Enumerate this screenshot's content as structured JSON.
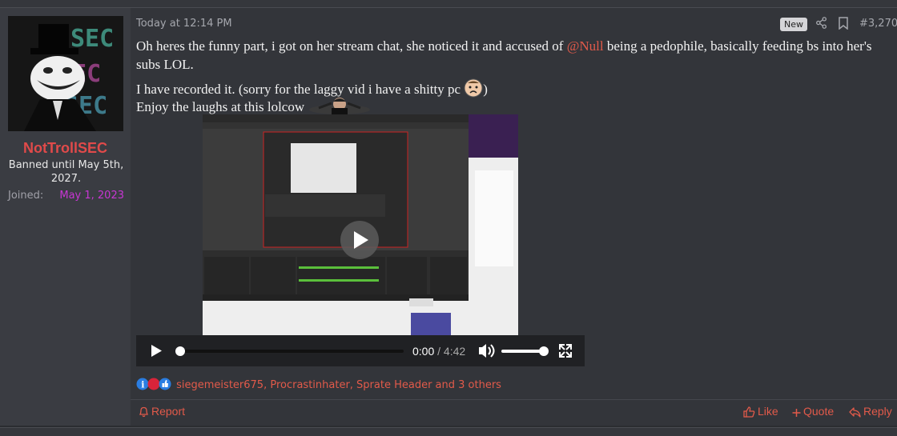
{
  "user": {
    "name": "NotTrollSEC",
    "banned": "Banned until May 5th, 2027.",
    "joined_label": "Joined:",
    "joined_value": "May 1, 2023",
    "avatar_text": "SEC"
  },
  "post": {
    "time": "Today at 12:14 PM",
    "new_badge": "New",
    "number": "#3,270",
    "line1_a": "Oh heres the funny part, i got on her stream chat, she noticed it and accused of ",
    "mention": "@Null",
    "line1_b": " being a pedophile, basically feeding bs into her's subs LOL.",
    "line2": "I have recorded it. (sorry for the laggy vid i have a shitty pc",
    "line2_end": ")",
    "line3": "Enjoy the laughs at this lolcow"
  },
  "video": {
    "time_current": "0:00",
    "time_sep": " / ",
    "time_total": "4:42",
    "progress": 0.0,
    "volume": 1.0
  },
  "reactions": {
    "text": "siegemeister675, Procrastinhater, Sprate Header and 3 others"
  },
  "footer": {
    "report": "Report",
    "like": "Like",
    "quote": "Quote",
    "reply": "Reply"
  },
  "colors": {
    "accent": "#e25a4a",
    "username": "#e14a4a",
    "joined": "#c836d4"
  }
}
